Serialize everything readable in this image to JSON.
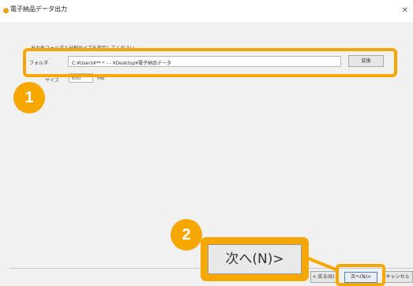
{
  "window": {
    "title": "電子納品データ出力",
    "close_glyph": "✕"
  },
  "form": {
    "instruction": "出力先フォルダと分割サイズを指定してください。",
    "folder_label": "フォルダ",
    "folder_value": "C:¥Users¥** * - - ¥Desktop¥電子納品データ",
    "change_label": "変換",
    "split_label": "サイズ",
    "split_value": "650",
    "split_unit": "MB"
  },
  "footer": {
    "back_label": "< 戻る(B)",
    "next_label": "次へ(N)>",
    "cancel_label": "キャンセル"
  },
  "annotations": {
    "badge1": "1",
    "badge2": "2",
    "zoom_label": "次へ(N)>",
    "highlight_color": "#f6a800"
  },
  "icons": {
    "app": "app-icon",
    "close": "close-icon"
  }
}
